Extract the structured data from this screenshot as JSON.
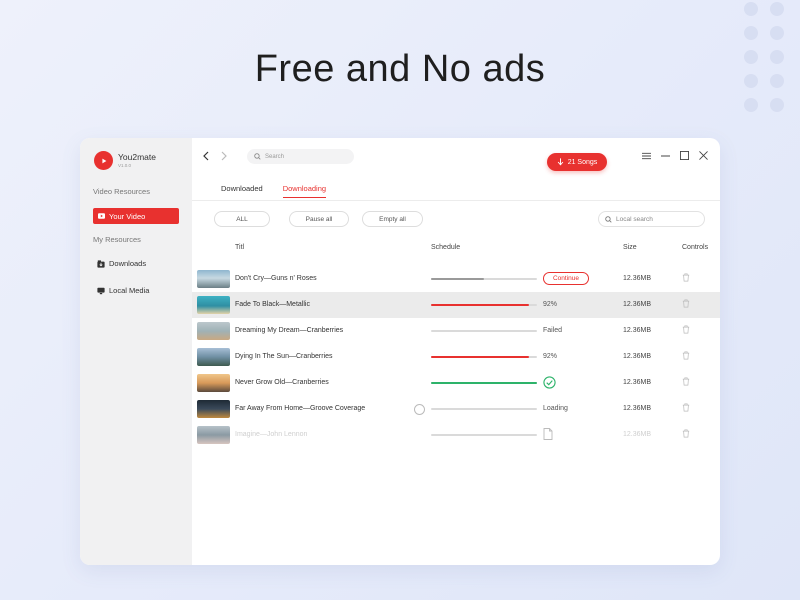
{
  "headline": "Free and No ads",
  "app": {
    "name": "You2mate",
    "version": "V1.0.0"
  },
  "sidebar": {
    "section_video": "Video Resources",
    "active_item": "Your Video",
    "section_my": "My Resources",
    "items": [
      {
        "label": "Downloads",
        "icon": "download-icon"
      },
      {
        "label": "Local Media",
        "icon": "monitor-icon"
      }
    ]
  },
  "topbar": {
    "search_placeholder": "Search",
    "songs_button": "21 Songs"
  },
  "tabs": [
    {
      "label": "Downloaded",
      "active": false
    },
    {
      "label": "Downloading",
      "active": true
    }
  ],
  "filters": {
    "all": "ALL",
    "pause_all": "Pause all",
    "empty_all": "Empty all",
    "local_search_placeholder": "Local search"
  },
  "columns": {
    "title": "Titl",
    "schedule": "Schedule",
    "size": "Size",
    "controls": "Controls"
  },
  "rows": [
    {
      "title": "Don't Cry—Guns n' Roses",
      "status": "Continue",
      "progress": 0.5,
      "bar_color": "#9a9a9a",
      "size": "12.36MB"
    },
    {
      "title": "Fade To Black—Metallic",
      "status": "92%",
      "progress": 0.92,
      "bar_color": "#e8312f",
      "size": "12.36MB"
    },
    {
      "title": "Dreaming My Dream—Cranberries",
      "status": "Failed",
      "progress": 0,
      "bar_color": "#dadada",
      "size": "12.36MB"
    },
    {
      "title": "Dying In The Sun—Cranberries",
      "status": "92%",
      "progress": 0.92,
      "bar_color": "#e8312f",
      "size": "12.36MB"
    },
    {
      "title": "Never Grow Old—Cranberries",
      "status": "",
      "progress": 1,
      "bar_color": "#2db36a",
      "size": "12.36MB"
    },
    {
      "title": "Far Away From Home—Groove Coverage",
      "status": "Loading",
      "progress": 0,
      "bar_color": "#dadada",
      "size": "12.36MB"
    },
    {
      "title": "Imagine—John Lennon",
      "status": "",
      "progress": 0,
      "bar_color": "#e6e6e6",
      "size": "12.36MB"
    }
  ],
  "colors": {
    "accent": "#e8312f",
    "success": "#2db36a"
  }
}
